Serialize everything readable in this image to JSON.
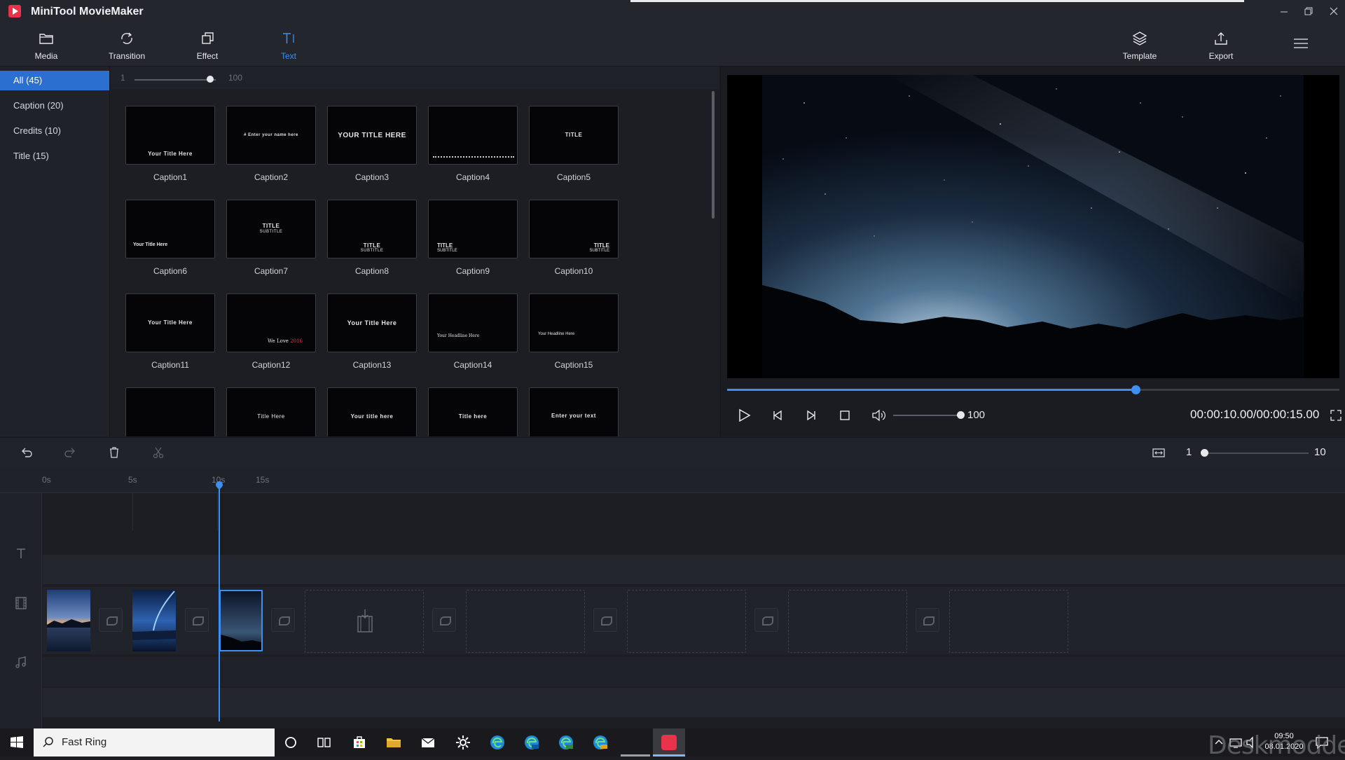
{
  "app": {
    "title": "MiniTool MovieMaker"
  },
  "toolbar": {
    "media": "Media",
    "transition": "Transition",
    "effect": "Effect",
    "text": "Text",
    "template": "Template",
    "export": "Export"
  },
  "categories": [
    {
      "label": "All",
      "count": "(45)"
    },
    {
      "label": "Caption",
      "count": "(20)"
    },
    {
      "label": "Credits",
      "count": "(10)"
    },
    {
      "label": "Title",
      "count": "(15)"
    }
  ],
  "size_slider": {
    "min": "1",
    "max": "100",
    "value_fraction": 0.93
  },
  "grid": {
    "captions": [
      "Caption1",
      "Caption2",
      "Caption3",
      "Caption4",
      "Caption5",
      "Caption6",
      "Caption7",
      "Caption8",
      "Caption9",
      "Caption10",
      "Caption11",
      "Caption12",
      "Caption13",
      "Caption14",
      "Caption15"
    ],
    "thumb_text": {
      "c1": "Your Title Here",
      "c2": "# Enter your name here",
      "c3": "YOUR TITLE HERE",
      "c5": "TITLE",
      "c6": "Your Title Here",
      "c7": "TITLE",
      "c7s": "SUBTITLE",
      "c8": "TITLE",
      "c8s": "SUBTITLE",
      "c9": "TITLE",
      "c9s": "SUBTITLE",
      "c10": "TITLE",
      "c10s": "SUBTITLE",
      "c11": "Your Title Here",
      "c12a": "We Love",
      "c12b": "2016",
      "c13": "Your Title Here",
      "c14": "Your Headline Here",
      "c15": "Your Headline Here",
      "r4b": "Title Here",
      "r4c": "Your title here",
      "r4d": "Title here",
      "r4e": "Enter your text"
    }
  },
  "player": {
    "progress_fraction": 0.667,
    "volume": "100",
    "volume_fraction": 1.0,
    "timecode": "00:00:10.00/00:00:15.00"
  },
  "timeline_zoom": {
    "min": "1",
    "max": "10",
    "value_fraction": 0.0
  },
  "ruler": [
    "0s",
    "5s",
    "10s",
    "15s"
  ],
  "taskbar": {
    "search": "Fast Ring",
    "time": "09:50",
    "date": "08.01.2020"
  },
  "watermark": "Deskmodder.de",
  "colors": {
    "accent": "#3f8ff0",
    "selected": "#2b6fd0",
    "brand": "#e8334a"
  }
}
